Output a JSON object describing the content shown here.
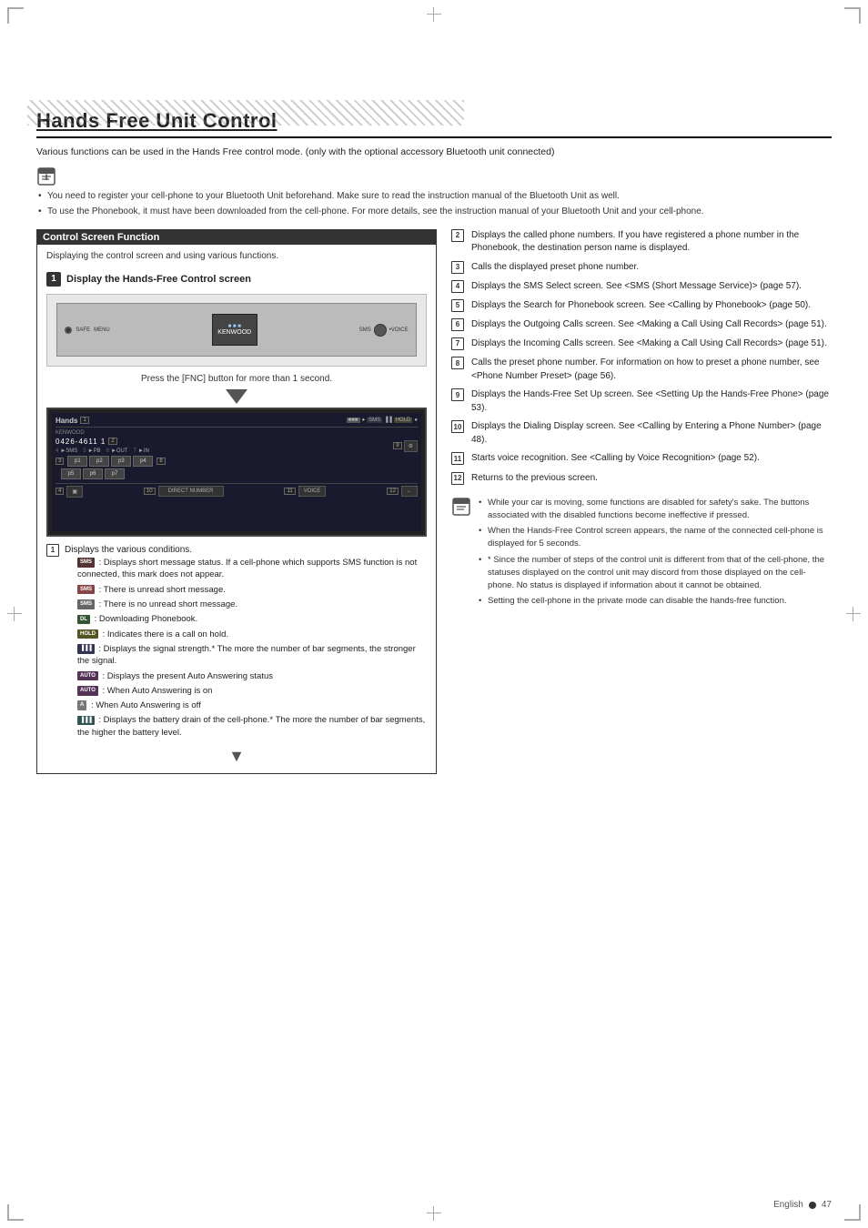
{
  "page": {
    "title": "Hands Free Unit Control",
    "intro": "Various functions can be used in the Hands Free control mode. (only with the optional accessory Bluetooth unit connected)",
    "footer": {
      "lang": "English",
      "page_num": "47"
    }
  },
  "notes_top": [
    "You need to register your cell-phone to your Bluetooth Unit beforehand. Make sure to read the instruction manual of the Bluetooth Unit as well.",
    "To use the Phonebook, it must have been downloaded from the cell-phone. For more details, see the instruction manual of your Bluetooth Unit and your cell-phone."
  ],
  "control_screen": {
    "title": "Control Screen Function",
    "subtitle": "Displaying the control screen and using various functions.",
    "step1_label": "Display the Hands-Free Control screen",
    "press_instruction": "Press the [FNC] button for more than 1 second.",
    "screen_elements": {
      "hands_label": "Hands",
      "phone_number": "0426-4611",
      "presets": [
        "p1",
        "p2",
        "p3",
        "p4",
        "p5",
        "p6"
      ],
      "buttons": [
        "DIRECT NUMBER",
        "VOICE"
      ]
    }
  },
  "left_descriptions": [
    {
      "num": "1",
      "text": "Displays the various conditions.",
      "sub_items": [
        {
          "badge": "SMS",
          "badge_class": "icon-badge-sms",
          "text": ": Displays short message status. If a cell-phone which supports SMS function is not connected, this mark does not appear."
        },
        {
          "badge": "SMS",
          "badge_variant": "unread",
          "text": ": There is unread short message."
        },
        {
          "badge": "SMS",
          "badge_variant": "read",
          "text": ": There is no unread short message."
        },
        {
          "badge": "DL",
          "badge_class": "icon-badge-dl",
          "text": ": Downloading Phonebook."
        },
        {
          "badge": "HOLD",
          "badge_class": "icon-badge-hold",
          "text": ": Indicates there is a call on hold."
        },
        {
          "badge": "SIG",
          "badge_class": "icon-badge-sig",
          "text": ": Displays the signal strength.*\nThe more the number of bar segments, the stronger the signal."
        },
        {
          "badge": "AUTO",
          "badge_class": "icon-badge-auto",
          "text": ": Displays the present Auto Answering status"
        },
        {
          "badge": "AUTO ON",
          "badge_class": "icon-badge-auto",
          "text": ": When Auto Answering is on"
        },
        {
          "badge": "A",
          "badge_class": "",
          "text": ": When Auto Answering is off"
        },
        {
          "badge": "BATT",
          "badge_class": "icon-badge-batt",
          "text": ": Displays the battery drain of the cell-phone.*\nThe more the number of bar segments, the higher the battery level."
        }
      ]
    }
  ],
  "right_descriptions": [
    {
      "num": "2",
      "text": "Displays the called phone numbers. If you have registered a phone number in the Phonebook, the destination person name is displayed."
    },
    {
      "num": "3",
      "text": "Calls the displayed preset phone number."
    },
    {
      "num": "4",
      "text": "Displays the SMS Select screen. See <SMS (Short Message Service)> (page 57)."
    },
    {
      "num": "5",
      "text": "Displays the Search for Phonebook screen. See <Calling by Phonebook> (page 50)."
    },
    {
      "num": "6",
      "text": "Displays the Outgoing Calls screen. See <Making a Call Using Call Records> (page 51)."
    },
    {
      "num": "7",
      "text": "Displays the Incoming Calls screen. See <Making a Call Using Call Records> (page 51)."
    },
    {
      "num": "8",
      "text": "Calls the preset phone number. For information on how to preset a phone number, see <Phone Number Preset> (page 56)."
    },
    {
      "num": "9",
      "text": "Displays the Hands-Free Set Up screen. See <Setting Up the Hands-Free Phone> (page 53)."
    },
    {
      "num": "10",
      "text": "Displays the Dialing Display screen. See <Calling by Entering a Phone Number> (page 48)."
    },
    {
      "num": "11",
      "text": "Starts voice recognition. See <Calling by Voice Recognition> (page 52)."
    },
    {
      "num": "12",
      "text": "Returns to the previous screen."
    }
  ],
  "notes_bottom": [
    "While your car is moving, some functions are disabled for safety's sake. The buttons associated with the disabled functions become ineffective if pressed.",
    "When the Hands-Free Control screen appears, the name of the connected cell-phone is displayed for 5 seconds.",
    "* Since the number of steps of the control unit is different from that of the cell-phone, the statuses displayed on the control unit may discord from those displayed on the cell-phone. No status is displayed if information about it cannot be obtained.",
    "Setting the cell-phone in the private mode can disable the hands-free function."
  ]
}
